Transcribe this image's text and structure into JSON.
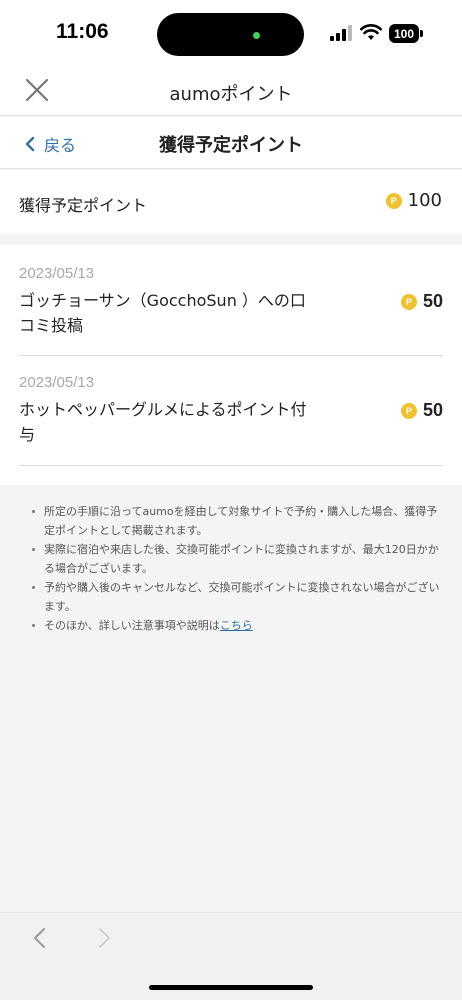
{
  "status_bar": {
    "time": "11:06",
    "battery": "100"
  },
  "modal": {
    "title": "aumoポイント"
  },
  "sub_header": {
    "back_label": "戻る",
    "title": "獲得予定ポイント"
  },
  "summary": {
    "label": "獲得予定ポイント",
    "points": "100",
    "coin_letter": "P"
  },
  "items": [
    {
      "date": "2023/05/13",
      "desc": "ゴッチョーサン（GocchoSun ）への口コミ投稿",
      "points": "50"
    },
    {
      "date": "2023/05/13",
      "desc": "ホットペッパーグルメによるポイント付与",
      "points": "50"
    }
  ],
  "notes": {
    "items": [
      "所定の手順に沿ってaumoを経由して対象サイトで予約・購入した場合、獲得予定ポイントとして掲載されます。",
      "実際に宿泊や来店した後、交換可能ポイントに変換されますが、最大120日かかる場合がございます。",
      "予約や購入後のキャンセルなど、交換可能ポイントに変換されない場合がございます。"
    ],
    "last_prefix": "そのほか、詳しい注意事項や説明は",
    "last_link": "こちら"
  },
  "colors": {
    "accent_link": "#2f6fa8",
    "coin": "#f2c12e"
  }
}
